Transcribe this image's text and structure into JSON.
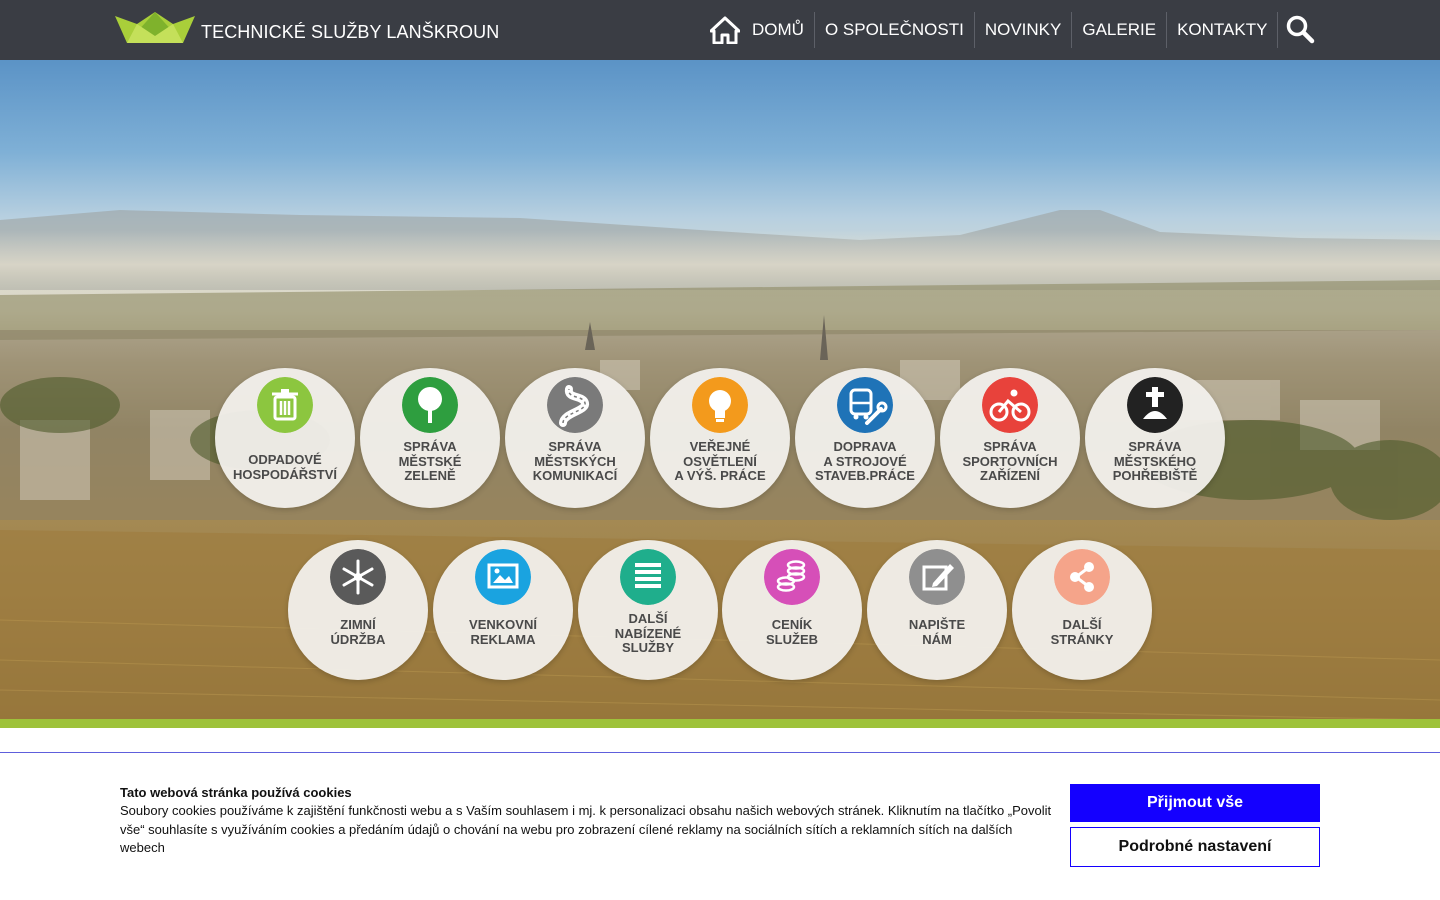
{
  "header": {
    "brand": "TECHNICKÉ SLUŽBY LANŠKROUN",
    "nav": [
      "DOMŮ",
      "O SPOLEČNOSTI",
      "NOVINKY",
      "GALERIE",
      "KONTAKTY"
    ],
    "logo_icon": "crown-logo-icon",
    "home_icon": "home-icon",
    "search_icon": "search-icon"
  },
  "services": [
    {
      "lines": [
        "ODPADOVÉ",
        "HOSPODÁŘSTVÍ"
      ],
      "icon": "trash-can-icon",
      "color": "#8cc63f"
    },
    {
      "lines": [
        "SPRÁVA",
        "MĚSTSKÉ",
        "ZELENĚ"
      ],
      "icon": "tree-icon",
      "color": "#2e9e3f"
    },
    {
      "lines": [
        "SPRÁVA",
        "MĚSTSKÝCH",
        "KOMUNIKACÍ"
      ],
      "icon": "road-icon",
      "color": "#7a7a7a"
    },
    {
      "lines": [
        "VEŘEJNÉ",
        "OSVĚTLENÍ",
        "A VÝŠ. PRÁCE"
      ],
      "icon": "light-bulb-icon",
      "color": "#f39a1c"
    },
    {
      "lines": [
        "DOPRAVA",
        "A STROJOVÉ",
        "STAVEB.PRÁCE"
      ],
      "icon": "bus-wrench-icon",
      "color": "#1f73b7"
    },
    {
      "lines": [
        "SPRÁVA",
        "SPORTOVNÍCH",
        "ZAŘÍZENÍ"
      ],
      "icon": "cyclist-icon",
      "color": "#e8423b"
    },
    {
      "lines": [
        "SPRÁVA",
        "MĚSTSKÉHO",
        "POHŘEBIŠTĚ"
      ],
      "icon": "grave-cross-icon",
      "color": "#222222"
    },
    {
      "lines": [
        "ZIMNÍ",
        "ÚDRŽBA"
      ],
      "icon": "snowflake-icon",
      "color": "#5a5a5a"
    },
    {
      "lines": [
        "VENKOVNÍ",
        "REKLAMA"
      ],
      "icon": "picture-icon",
      "color": "#1aa3e0"
    },
    {
      "lines": [
        "DALŠÍ",
        "NABÍZENÉ",
        "SLUŽBY"
      ],
      "icon": "list-icon",
      "color": "#1fae8c"
    },
    {
      "lines": [
        "CENÍK",
        "SLUŽEB"
      ],
      "icon": "coins-icon",
      "color": "#d64fb8"
    },
    {
      "lines": [
        "NAPIŠTE",
        "NÁM"
      ],
      "icon": "pencil-note-icon",
      "color": "#8f8f8f"
    },
    {
      "lines": [
        "DALŠÍ",
        "STRÁNKY"
      ],
      "icon": "share-icon",
      "color": "#f5a48a"
    }
  ],
  "cookie": {
    "title": "Tato webová stránka používá cookies",
    "text": "Soubory cookies používáme k zajištění funkčnosti webu a s Vaším souhlasem i mj. k personalizaci obsahu našich webových stránek. Kliknutím na tlačítko „Povolit vše“ souhlasíte s využíváním cookies a předáním údajů o chování na webu pro zobrazení cílené reklamy na sociálních sítích a reklamních sítích na dalších webech",
    "accept_label": "Přijmout vše",
    "settings_label": "Podrobné nastavení"
  },
  "colors": {
    "header_bg": "#3a3d44",
    "accent_green": "#9ec23a",
    "cookie_button_blue": "#1400ff"
  }
}
